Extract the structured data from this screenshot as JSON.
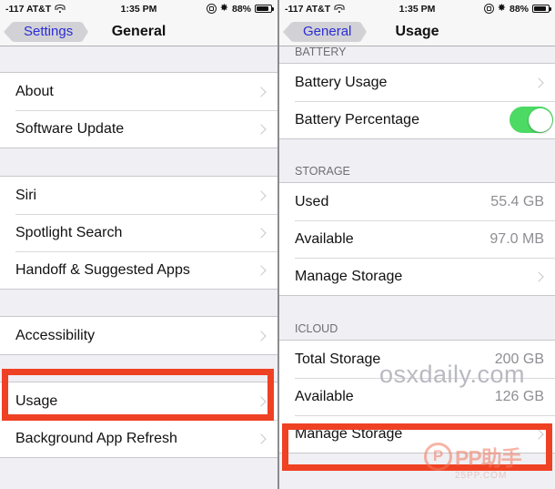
{
  "status_bar": {
    "carrier": "-117 AT&T",
    "wifi_icon": "wifi-icon",
    "time": "1:35 PM",
    "rotation_lock_icon": "rotation-lock-icon",
    "bluetooth_icon": "bluetooth-icon",
    "bluetooth_glyph": "✸",
    "battery_percent": "88%",
    "battery_fill": 88
  },
  "left_screen": {
    "nav": {
      "back_label": "Settings",
      "title": "General"
    },
    "groups": [
      {
        "rows": [
          {
            "label": "About",
            "value": "",
            "accessory": "chevron"
          },
          {
            "label": "Software Update",
            "value": "",
            "accessory": "chevron"
          }
        ]
      },
      {
        "rows": [
          {
            "label": "Siri",
            "value": "",
            "accessory": "chevron"
          },
          {
            "label": "Spotlight Search",
            "value": "",
            "accessory": "chevron"
          },
          {
            "label": "Handoff & Suggested Apps",
            "value": "",
            "accessory": "chevron"
          }
        ]
      },
      {
        "rows": [
          {
            "label": "Accessibility",
            "value": "",
            "accessory": "chevron"
          }
        ]
      },
      {
        "rows": [
          {
            "label": "Usage",
            "value": "",
            "accessory": "chevron",
            "highlighted": true
          },
          {
            "label": "Background App Refresh",
            "value": "",
            "accessory": "chevron"
          }
        ]
      }
    ]
  },
  "right_screen": {
    "nav": {
      "back_label": "General",
      "title": "Usage"
    },
    "sections": [
      {
        "header": "BATTERY",
        "rows": [
          {
            "label": "Battery Usage",
            "value": "",
            "accessory": "chevron"
          },
          {
            "label": "Battery Percentage",
            "value": "",
            "accessory": "toggle",
            "toggle_on": true
          }
        ]
      },
      {
        "header": "STORAGE",
        "rows": [
          {
            "label": "Used",
            "value": "55.4 GB",
            "accessory": "none"
          },
          {
            "label": "Available",
            "value": "97.0 MB",
            "accessory": "none"
          },
          {
            "label": "Manage Storage",
            "value": "",
            "accessory": "chevron"
          }
        ]
      },
      {
        "header": "ICLOUD",
        "rows": [
          {
            "label": "Total Storage",
            "value": "200 GB",
            "accessory": "none"
          },
          {
            "label": "Available",
            "value": "126 GB",
            "accessory": "none"
          },
          {
            "label": "Manage Storage",
            "value": "",
            "accessory": "chevron",
            "highlighted": true
          }
        ]
      }
    ]
  },
  "watermarks": {
    "osxdaily": "osxdaily.com",
    "pp_logo_letter": "P",
    "pp_name": "PP助手",
    "pp_url": "25PP.COM"
  },
  "colors": {
    "highlight_red": "#ef4123",
    "toggle_green": "#4cd964",
    "link_blue": "#2c2cd6",
    "section_header": "#6d6d72",
    "value_gray": "#8e8e93",
    "page_bg": "#efeff4"
  }
}
